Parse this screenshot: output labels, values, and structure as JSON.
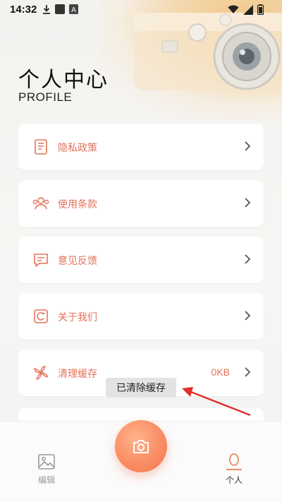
{
  "status_bar": {
    "time": "14:32"
  },
  "header": {
    "title": "个人中心",
    "subtitle": "PROFILE"
  },
  "menu": [
    {
      "label": "隐私政策",
      "icon": "book-icon"
    },
    {
      "label": "使用条款",
      "icon": "users-icon"
    },
    {
      "label": "意见反馈",
      "icon": "feedback-icon"
    },
    {
      "label": "关于我们",
      "icon": "info-icon"
    },
    {
      "label": "清理缓存",
      "icon": "fan-icon",
      "value": "0KB"
    }
  ],
  "toast": {
    "text": "已清除缓存"
  },
  "tabbar": {
    "edit_label": "编辑",
    "profile_label": "个人"
  },
  "colors": {
    "accent": "#e2735a",
    "active_tab": "#f08a63",
    "inactive_tab": "#9a9a9a"
  }
}
